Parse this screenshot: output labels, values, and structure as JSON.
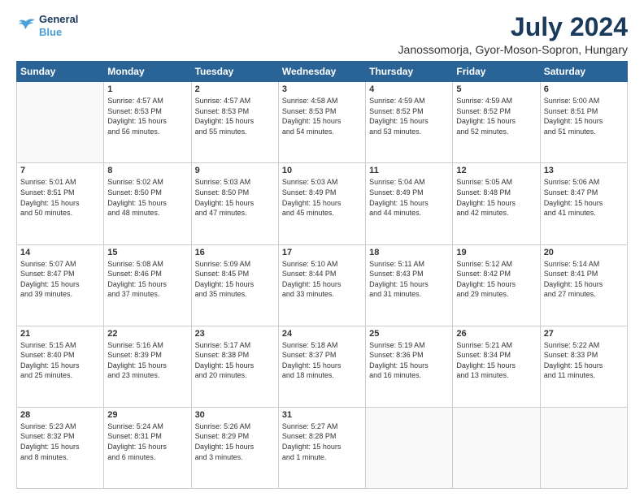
{
  "header": {
    "logo_line1": "General",
    "logo_line2": "Blue",
    "title": "July 2024",
    "subtitle": "Janossomorja, Gyor-Moson-Sopron, Hungary"
  },
  "days_of_week": [
    "Sunday",
    "Monday",
    "Tuesday",
    "Wednesday",
    "Thursday",
    "Friday",
    "Saturday"
  ],
  "weeks": [
    [
      {
        "day": "",
        "info": ""
      },
      {
        "day": "1",
        "info": "Sunrise: 4:57 AM\nSunset: 8:53 PM\nDaylight: 15 hours\nand 56 minutes."
      },
      {
        "day": "2",
        "info": "Sunrise: 4:57 AM\nSunset: 8:53 PM\nDaylight: 15 hours\nand 55 minutes."
      },
      {
        "day": "3",
        "info": "Sunrise: 4:58 AM\nSunset: 8:53 PM\nDaylight: 15 hours\nand 54 minutes."
      },
      {
        "day": "4",
        "info": "Sunrise: 4:59 AM\nSunset: 8:52 PM\nDaylight: 15 hours\nand 53 minutes."
      },
      {
        "day": "5",
        "info": "Sunrise: 4:59 AM\nSunset: 8:52 PM\nDaylight: 15 hours\nand 52 minutes."
      },
      {
        "day": "6",
        "info": "Sunrise: 5:00 AM\nSunset: 8:51 PM\nDaylight: 15 hours\nand 51 minutes."
      }
    ],
    [
      {
        "day": "7",
        "info": "Sunrise: 5:01 AM\nSunset: 8:51 PM\nDaylight: 15 hours\nand 50 minutes."
      },
      {
        "day": "8",
        "info": "Sunrise: 5:02 AM\nSunset: 8:50 PM\nDaylight: 15 hours\nand 48 minutes."
      },
      {
        "day": "9",
        "info": "Sunrise: 5:03 AM\nSunset: 8:50 PM\nDaylight: 15 hours\nand 47 minutes."
      },
      {
        "day": "10",
        "info": "Sunrise: 5:03 AM\nSunset: 8:49 PM\nDaylight: 15 hours\nand 45 minutes."
      },
      {
        "day": "11",
        "info": "Sunrise: 5:04 AM\nSunset: 8:49 PM\nDaylight: 15 hours\nand 44 minutes."
      },
      {
        "day": "12",
        "info": "Sunrise: 5:05 AM\nSunset: 8:48 PM\nDaylight: 15 hours\nand 42 minutes."
      },
      {
        "day": "13",
        "info": "Sunrise: 5:06 AM\nSunset: 8:47 PM\nDaylight: 15 hours\nand 41 minutes."
      }
    ],
    [
      {
        "day": "14",
        "info": "Sunrise: 5:07 AM\nSunset: 8:47 PM\nDaylight: 15 hours\nand 39 minutes."
      },
      {
        "day": "15",
        "info": "Sunrise: 5:08 AM\nSunset: 8:46 PM\nDaylight: 15 hours\nand 37 minutes."
      },
      {
        "day": "16",
        "info": "Sunrise: 5:09 AM\nSunset: 8:45 PM\nDaylight: 15 hours\nand 35 minutes."
      },
      {
        "day": "17",
        "info": "Sunrise: 5:10 AM\nSunset: 8:44 PM\nDaylight: 15 hours\nand 33 minutes."
      },
      {
        "day": "18",
        "info": "Sunrise: 5:11 AM\nSunset: 8:43 PM\nDaylight: 15 hours\nand 31 minutes."
      },
      {
        "day": "19",
        "info": "Sunrise: 5:12 AM\nSunset: 8:42 PM\nDaylight: 15 hours\nand 29 minutes."
      },
      {
        "day": "20",
        "info": "Sunrise: 5:14 AM\nSunset: 8:41 PM\nDaylight: 15 hours\nand 27 minutes."
      }
    ],
    [
      {
        "day": "21",
        "info": "Sunrise: 5:15 AM\nSunset: 8:40 PM\nDaylight: 15 hours\nand 25 minutes."
      },
      {
        "day": "22",
        "info": "Sunrise: 5:16 AM\nSunset: 8:39 PM\nDaylight: 15 hours\nand 23 minutes."
      },
      {
        "day": "23",
        "info": "Sunrise: 5:17 AM\nSunset: 8:38 PM\nDaylight: 15 hours\nand 20 minutes."
      },
      {
        "day": "24",
        "info": "Sunrise: 5:18 AM\nSunset: 8:37 PM\nDaylight: 15 hours\nand 18 minutes."
      },
      {
        "day": "25",
        "info": "Sunrise: 5:19 AM\nSunset: 8:36 PM\nDaylight: 15 hours\nand 16 minutes."
      },
      {
        "day": "26",
        "info": "Sunrise: 5:21 AM\nSunset: 8:34 PM\nDaylight: 15 hours\nand 13 minutes."
      },
      {
        "day": "27",
        "info": "Sunrise: 5:22 AM\nSunset: 8:33 PM\nDaylight: 15 hours\nand 11 minutes."
      }
    ],
    [
      {
        "day": "28",
        "info": "Sunrise: 5:23 AM\nSunset: 8:32 PM\nDaylight: 15 hours\nand 8 minutes."
      },
      {
        "day": "29",
        "info": "Sunrise: 5:24 AM\nSunset: 8:31 PM\nDaylight: 15 hours\nand 6 minutes."
      },
      {
        "day": "30",
        "info": "Sunrise: 5:26 AM\nSunset: 8:29 PM\nDaylight: 15 hours\nand 3 minutes."
      },
      {
        "day": "31",
        "info": "Sunrise: 5:27 AM\nSunset: 8:28 PM\nDaylight: 15 hours\nand 1 minute."
      },
      {
        "day": "",
        "info": ""
      },
      {
        "day": "",
        "info": ""
      },
      {
        "day": "",
        "info": ""
      }
    ]
  ]
}
